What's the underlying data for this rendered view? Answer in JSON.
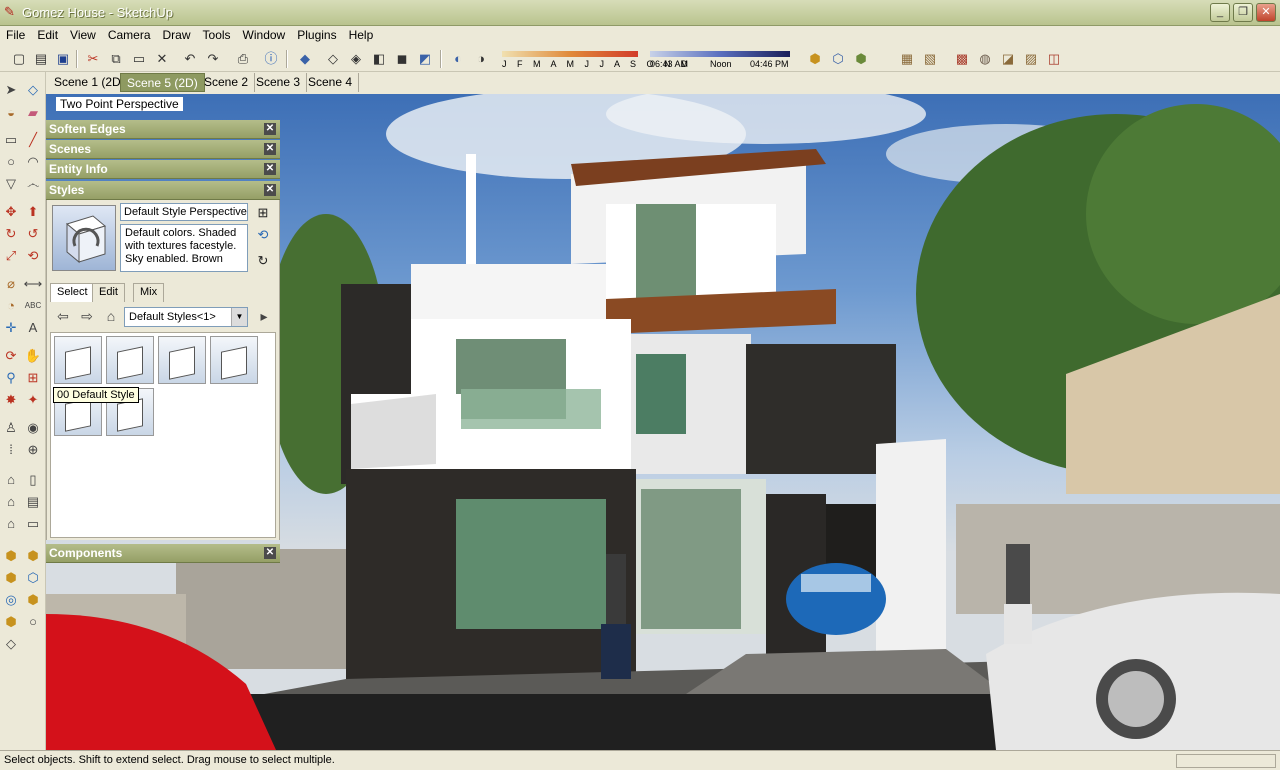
{
  "window": {
    "title": "Gomez House - SketchUp"
  },
  "menu": [
    "File",
    "Edit",
    "View",
    "Camera",
    "Draw",
    "Tools",
    "Window",
    "Plugins",
    "Help"
  ],
  "shadows": {
    "months": "J F M A M J J A S O N D",
    "time_start": "06:43 AM",
    "time_mid": "Noon",
    "time_end": "04:46 PM"
  },
  "scenes": [
    "Scene 1 (2D)",
    "Scene 5 (2D)",
    "Scene 2",
    "Scene 3",
    "Scene 4"
  ],
  "active_scene_index": 1,
  "viewport": {
    "camera_label": "Two Point Perspective"
  },
  "panels": {
    "soften_edges": "Soften Edges",
    "scenes": "Scenes",
    "entity_info": "Entity Info",
    "styles": "Styles",
    "components": "Components"
  },
  "styles": {
    "name": "Default Style Perspective",
    "description": "Default colors.  Shaded with textures facestyle.  Sky enabled.  Brown",
    "tabs": [
      "Select",
      "Edit",
      "Mix"
    ],
    "collection": "Default Styles<1>",
    "tooltip": "00 Default Style"
  },
  "status": {
    "text": "Select objects. Shift to extend select. Drag mouse to select multiple."
  },
  "colors": {
    "title_green": "#b9c38e",
    "active_tab": "#8e9a61",
    "panel_head": "#959f66"
  }
}
